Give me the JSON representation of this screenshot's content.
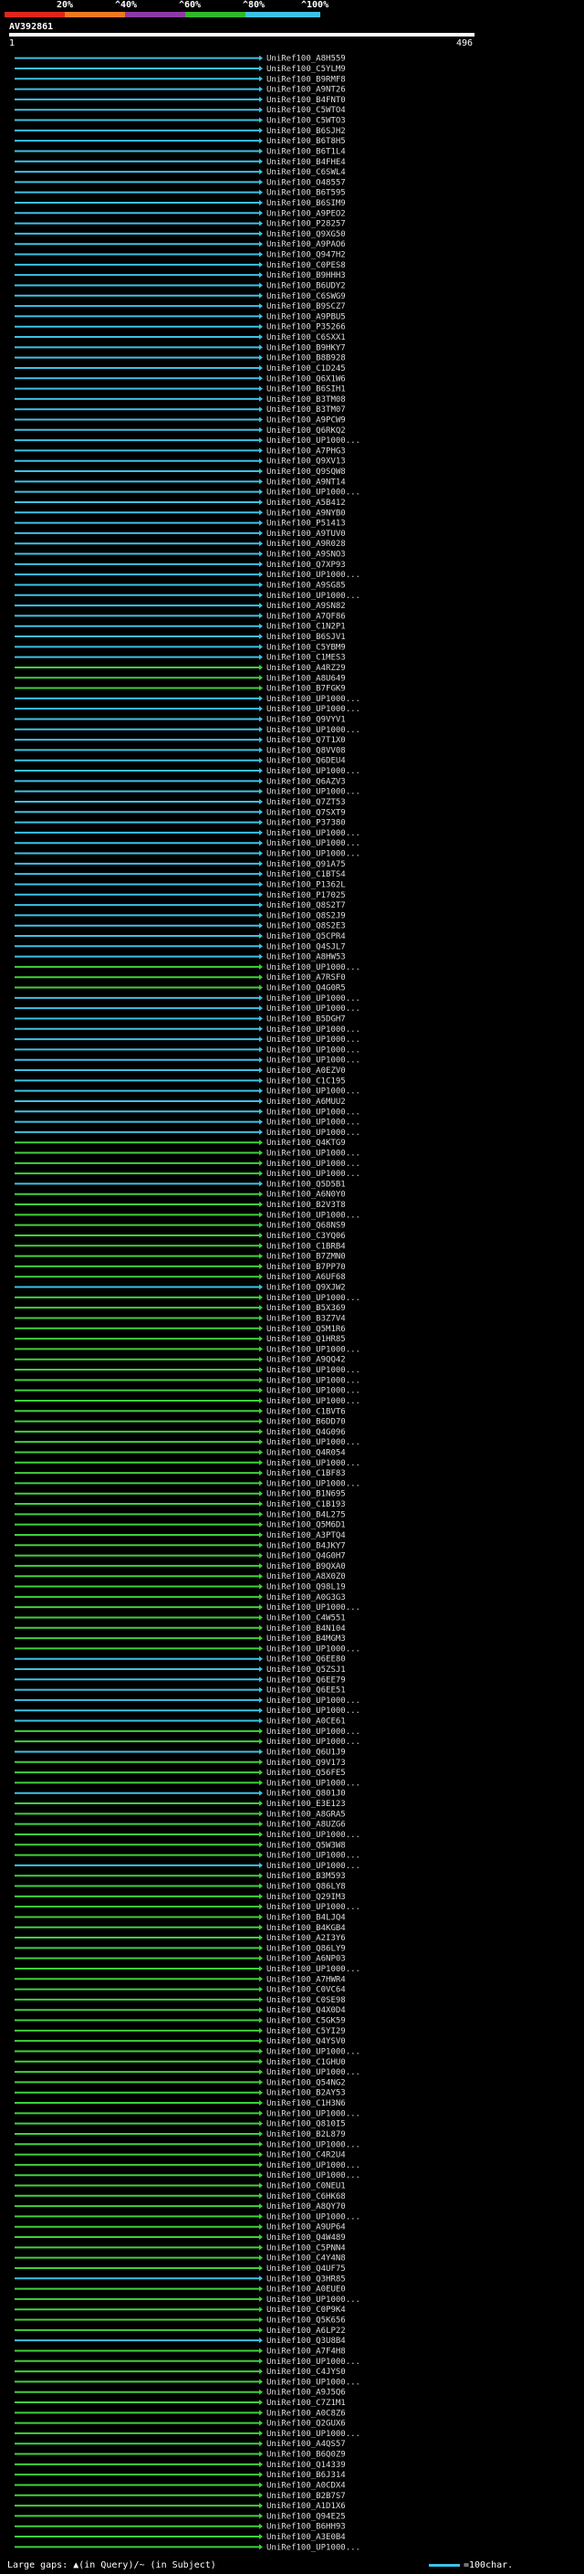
{
  "colors": {
    "bg": "#000000",
    "blue": "#3cc3e6",
    "green": "#3ed23a",
    "gap": "#ffd23c",
    "label": "#dddddd",
    "scale": [
      "#e1261c",
      "#ee7a20",
      "#8c3aa6",
      "#2fb82a",
      "#3cc3e6"
    ]
  },
  "scale": {
    "labels": [
      "20%",
      "^40%",
      "^60%",
      "^80%",
      "^100%"
    ]
  },
  "query": {
    "id": "AV392861",
    "start": "1",
    "end": "496"
  },
  "legend": {
    "gaps": "Large gaps: ▲(in Query)/~ (in Subject)",
    "unit": "=100char."
  },
  "hits": [
    {
      "id": "UniRef100_A8H559",
      "color": "blue"
    },
    {
      "id": "UniRef100_C5YLM9",
      "color": "blue"
    },
    {
      "id": "UniRef100_B9RMF8",
      "color": "blue"
    },
    {
      "id": "UniRef100_A9NT26",
      "color": "blue"
    },
    {
      "id": "UniRef100_B4FNT0",
      "color": "blue"
    },
    {
      "id": "UniRef100_C5WTO4",
      "color": "blue"
    },
    {
      "id": "UniRef100_C5WTO3",
      "color": "blue"
    },
    {
      "id": "UniRef100_B6SJH2",
      "color": "blue"
    },
    {
      "id": "UniRef100_B6T8H5",
      "color": "blue"
    },
    {
      "id": "UniRef100_B6T1L4",
      "color": "blue"
    },
    {
      "id": "UniRef100_B4FHE4",
      "color": "blue"
    },
    {
      "id": "UniRef100_C6SWL4",
      "color": "blue"
    },
    {
      "id": "UniRef100_O48557",
      "color": "blue"
    },
    {
      "id": "UniRef100_B6T595",
      "color": "blue"
    },
    {
      "id": "UniRef100_B6SIM9",
      "color": "blue"
    },
    {
      "id": "UniRef100_A9PEO2",
      "color": "blue"
    },
    {
      "id": "UniRef100_P28257",
      "color": "blue"
    },
    {
      "id": "UniRef100_Q9XG50",
      "color": "blue"
    },
    {
      "id": "UniRef100_A9PAO6",
      "color": "blue"
    },
    {
      "id": "UniRef100_Q947H2",
      "color": "blue"
    },
    {
      "id": "UniRef100_C0PES8",
      "color": "blue"
    },
    {
      "id": "UniRef100_B9HHH3",
      "color": "blue"
    },
    {
      "id": "UniRef100_B6UDY2",
      "color": "blue"
    },
    {
      "id": "UniRef100_C6SWG9",
      "color": "blue"
    },
    {
      "id": "UniRef100_B9SCZ7",
      "color": "blue"
    },
    {
      "id": "UniRef100_A9PBU5",
      "color": "blue"
    },
    {
      "id": "UniRef100_P35266",
      "color": "blue"
    },
    {
      "id": "UniRef100_C6SXX1",
      "color": "blue"
    },
    {
      "id": "UniRef100_B9HKY7",
      "color": "blue"
    },
    {
      "id": "UniRef100_B8B928",
      "color": "blue"
    },
    {
      "id": "UniRef100_C1D245",
      "color": "blue"
    },
    {
      "id": "UniRef100_Q6X1W6",
      "color": "blue"
    },
    {
      "id": "UniRef100_B6SIH1",
      "color": "blue"
    },
    {
      "id": "UniRef100_B3TM08",
      "color": "blue"
    },
    {
      "id": "UniRef100_B3TM07",
      "color": "blue"
    },
    {
      "id": "UniRef100_A9PCW9",
      "color": "blue"
    },
    {
      "id": "UniRef100_Q6RKQ2",
      "color": "blue"
    },
    {
      "id": "UniRef100_UP1000...",
      "color": "blue"
    },
    {
      "id": "UniRef100_A7PHG3",
      "color": "blue"
    },
    {
      "id": "UniRef100_Q9XV13",
      "color": "blue"
    },
    {
      "id": "UniRef100_Q9SQW8",
      "color": "blue"
    },
    {
      "id": "UniRef100_A9NT14",
      "color": "blue"
    },
    {
      "id": "UniRef100_UP1000...",
      "color": "blue"
    },
    {
      "id": "UniRef100_A5B412",
      "color": "blue"
    },
    {
      "id": "UniRef100_A9NYB0",
      "color": "blue"
    },
    {
      "id": "UniRef100_P51413",
      "color": "blue"
    },
    {
      "id": "UniRef100_A9TUV0",
      "color": "blue"
    },
    {
      "id": "UniRef100_A9R028",
      "color": "blue"
    },
    {
      "id": "UniRef100_A9SNO3",
      "color": "blue"
    },
    {
      "id": "UniRef100_Q7XP93",
      "color": "blue"
    },
    {
      "id": "UniRef100_UP1000...",
      "color": "blue"
    },
    {
      "id": "UniRef100_A9SG85",
      "color": "blue"
    },
    {
      "id": "UniRef100_UP1000...",
      "color": "blue"
    },
    {
      "id": "UniRef100_A9SN82",
      "color": "blue"
    },
    {
      "id": "UniRef100_A7QF86",
      "color": "blue"
    },
    {
      "id": "UniRef100_C1N2P1",
      "color": "blue"
    },
    {
      "id": "UniRef100_B6SJV1",
      "color": "blue"
    },
    {
      "id": "UniRef100_C5YBM9",
      "color": "blue"
    },
    {
      "id": "UniRef100_C1MES3",
      "color": "blue"
    },
    {
      "id": "UniRef100_A4RZ29",
      "color": "green"
    },
    {
      "id": "UniRef100_A8U649",
      "color": "green"
    },
    {
      "id": "UniRef100_B7FGK9",
      "color": "green"
    },
    {
      "id": "UniRef100_UP1000...",
      "color": "blue"
    },
    {
      "id": "UniRef100_UP1000...",
      "color": "blue"
    },
    {
      "id": "UniRef100_Q9VYV1",
      "color": "blue"
    },
    {
      "id": "UniRef100_UP1000...",
      "color": "blue"
    },
    {
      "id": "UniRef100_Q7T1X0",
      "color": "blue"
    },
    {
      "id": "UniRef100_Q8VV08",
      "color": "blue"
    },
    {
      "id": "UniRef100_Q6DEU4",
      "color": "blue"
    },
    {
      "id": "UniRef100_UP1000...",
      "color": "blue"
    },
    {
      "id": "UniRef100_Q6AZV3",
      "color": "blue"
    },
    {
      "id": "UniRef100_UP1000...",
      "color": "blue"
    },
    {
      "id": "UniRef100_Q7ZT53",
      "color": "blue"
    },
    {
      "id": "UniRef100_Q7SXT9",
      "color": "blue"
    },
    {
      "id": "UniRef100_P37380",
      "color": "blue"
    },
    {
      "id": "UniRef100_UP1000...",
      "color": "blue"
    },
    {
      "id": "UniRef100_UP1000...",
      "color": "blue"
    },
    {
      "id": "UniRef100_UP1000...",
      "color": "blue"
    },
    {
      "id": "UniRef100_Q91A75",
      "color": "blue"
    },
    {
      "id": "UniRef100_C1BTS4",
      "color": "blue"
    },
    {
      "id": "UniRef100_P1362L",
      "color": "blue"
    },
    {
      "id": "UniRef100_P17025",
      "color": "blue"
    },
    {
      "id": "UniRef100_Q8S2T7",
      "color": "blue"
    },
    {
      "id": "UniRef100_Q8S2J9",
      "color": "blue"
    },
    {
      "id": "UniRef100_Q8S2E3",
      "color": "blue"
    },
    {
      "id": "UniRef100_Q5CPR4",
      "color": "blue"
    },
    {
      "id": "UniRef100_Q4SJL7",
      "color": "blue"
    },
    {
      "id": "UniRef100_A8HW53",
      "color": "blue"
    },
    {
      "id": "UniRef100_UP1000...",
      "color": "green"
    },
    {
      "id": "UniRef100_A7RSF0",
      "color": "green"
    },
    {
      "id": "UniRef100_Q4G0R5",
      "color": "green"
    },
    {
      "id": "UniRef100_UP1000...",
      "color": "blue"
    },
    {
      "id": "UniRef100_UP1000...",
      "color": "blue"
    },
    {
      "id": "UniRef100_B5DGH7",
      "color": "blue"
    },
    {
      "id": "UniRef100_UP1000...",
      "color": "blue"
    },
    {
      "id": "UniRef100_UP1000...",
      "color": "blue"
    },
    {
      "id": "UniRef100_UP1000...",
      "color": "blue"
    },
    {
      "id": "UniRef100_UP1000...",
      "color": "blue"
    },
    {
      "id": "UniRef100_A0EZV0",
      "color": "blue"
    },
    {
      "id": "UniRef100_C1C195",
      "color": "blue"
    },
    {
      "id": "UniRef100_UP1000...",
      "color": "blue"
    },
    {
      "id": "UniRef100_A6MUU2",
      "color": "blue"
    },
    {
      "id": "UniRef100_UP1000...",
      "color": "blue"
    },
    {
      "id": "UniRef100_UP1000...",
      "color": "blue"
    },
    {
      "id": "UniRef100_UP1000...",
      "color": "blue"
    },
    {
      "id": "UniRef100_Q4KTG9",
      "color": "green"
    },
    {
      "id": "UniRef100_UP1000...",
      "color": "green"
    },
    {
      "id": "UniRef100_UP1000...",
      "color": "green"
    },
    {
      "id": "UniRef100_UP1000...",
      "color": "green"
    },
    {
      "id": "UniRef100_Q5D5B1",
      "color": "blue"
    },
    {
      "id": "UniRef100_A6N0Y0",
      "color": "green"
    },
    {
      "id": "UniRef100_B2V3T8",
      "color": "green"
    },
    {
      "id": "UniRef100_UP1000...",
      "color": "green"
    },
    {
      "id": "UniRef100_Q68NS9",
      "color": "green"
    },
    {
      "id": "UniRef100_C3YQ06",
      "color": "green"
    },
    {
      "id": "UniRef100_C1BRB4",
      "color": "green"
    },
    {
      "id": "UniRef100_B7ZMN0",
      "color": "green"
    },
    {
      "id": "UniRef100_B7PP70",
      "color": "green"
    },
    {
      "id": "UniRef100_A6UF68",
      "color": "green"
    },
    {
      "id": "UniRef100_Q9XJW2",
      "color": "blue"
    },
    {
      "id": "UniRef100_UP1000...",
      "color": "green"
    },
    {
      "id": "UniRef100_B5X369",
      "color": "green"
    },
    {
      "id": "UniRef100_B3Z7V4",
      "color": "green"
    },
    {
      "id": "UniRef100_Q5M1R6",
      "color": "green"
    },
    {
      "id": "UniRef100_Q1HR85",
      "color": "green"
    },
    {
      "id": "UniRef100_UP1000...",
      "color": "green"
    },
    {
      "id": "UniRef100_A9QQ42",
      "color": "green"
    },
    {
      "id": "UniRef100_UP1000...",
      "color": "green"
    },
    {
      "id": "UniRef100_UP1000...",
      "color": "green"
    },
    {
      "id": "UniRef100_UP1000...",
      "color": "green"
    },
    {
      "id": "UniRef100_UP1000...",
      "color": "green"
    },
    {
      "id": "UniRef100_C1BVT6",
      "color": "green"
    },
    {
      "id": "UniRef100_B6DD70",
      "color": "green"
    },
    {
      "id": "UniRef100_Q4G096",
      "color": "green"
    },
    {
      "id": "UniRef100_UP1000...",
      "color": "green"
    },
    {
      "id": "UniRef100_Q4R054",
      "color": "green"
    },
    {
      "id": "UniRef100_UP1000...",
      "color": "green"
    },
    {
      "id": "UniRef100_C1BF83",
      "color": "green"
    },
    {
      "id": "UniRef100_UP1000...",
      "color": "green"
    },
    {
      "id": "UniRef100_B1N695",
      "color": "green"
    },
    {
      "id": "UniRef100_C1B193",
      "color": "green"
    },
    {
      "id": "UniRef100_B4L275",
      "color": "green"
    },
    {
      "id": "UniRef100_Q5M6D1",
      "color": "green"
    },
    {
      "id": "UniRef100_A3PTQ4",
      "color": "green"
    },
    {
      "id": "UniRef100_B4JKY7",
      "color": "green"
    },
    {
      "id": "UniRef100_Q4G0H7",
      "color": "green"
    },
    {
      "id": "UniRef100_B9QXA0",
      "color": "green"
    },
    {
      "id": "UniRef100_A8X0Z0",
      "color": "green"
    },
    {
      "id": "UniRef100_Q98L19",
      "color": "green"
    },
    {
      "id": "UniRef100_A0G3G3",
      "color": "green"
    },
    {
      "id": "UniRef100_UP1000...",
      "color": "green"
    },
    {
      "id": "UniRef100_C4W551",
      "color": "green"
    },
    {
      "id": "UniRef100_B4N104",
      "color": "green"
    },
    {
      "id": "UniRef100_B4MGM3",
      "color": "green"
    },
    {
      "id": "UniRef100_UP1000...",
      "color": "green"
    },
    {
      "id": "UniRef100_Q6EE80",
      "color": "blue"
    },
    {
      "id": "UniRef100_Q5ZSJ1",
      "color": "blue"
    },
    {
      "id": "UniRef100_Q6EE79",
      "color": "blue"
    },
    {
      "id": "UniRef100_Q6EE51",
      "color": "blue"
    },
    {
      "id": "UniRef100_UP1000...",
      "color": "blue"
    },
    {
      "id": "UniRef100_UP1000...",
      "color": "blue"
    },
    {
      "id": "UniRef100_A0CE61",
      "color": "blue"
    },
    {
      "id": "UniRef100_UP1000...",
      "color": "green"
    },
    {
      "id": "UniRef100_UP1000...",
      "color": "green"
    },
    {
      "id": "UniRef100_Q6U1J9",
      "color": "blue"
    },
    {
      "id": "UniRef100_Q9V173",
      "color": "green"
    },
    {
      "id": "UniRef100_Q56FE5",
      "color": "green"
    },
    {
      "id": "UniRef100_UP1000...",
      "color": "green"
    },
    {
      "id": "UniRef100_Q801J0",
      "color": "blue"
    },
    {
      "id": "UniRef100_E3E123",
      "color": "green"
    },
    {
      "id": "UniRef100_A8GRA5",
      "color": "green"
    },
    {
      "id": "UniRef100_A8UZG6",
      "color": "green"
    },
    {
      "id": "UniRef100_UP1000...",
      "color": "green"
    },
    {
      "id": "UniRef100_Q5W3W8",
      "color": "green"
    },
    {
      "id": "UniRef100_UP1000...",
      "color": "green"
    },
    {
      "id": "UniRef100_UP1000...",
      "color": "blue"
    },
    {
      "id": "UniRef100_B3M593",
      "color": "green"
    },
    {
      "id": "UniRef100_Q86LY8",
      "color": "green"
    },
    {
      "id": "UniRef100_Q29IM3",
      "color": "green"
    },
    {
      "id": "UniRef100_UP1000...",
      "color": "green"
    },
    {
      "id": "UniRef100_B4LJQ4",
      "color": "green"
    },
    {
      "id": "UniRef100_B4KGB4",
      "color": "green"
    },
    {
      "id": "UniRef100_A2I3Y6",
      "color": "green"
    },
    {
      "id": "UniRef100_Q86LY9",
      "color": "green"
    },
    {
      "id": "UniRef100_A6NP03",
      "color": "green"
    },
    {
      "id": "UniRef100_UP1000...",
      "color": "green"
    },
    {
      "id": "UniRef100_A7HWR4",
      "color": "green"
    },
    {
      "id": "UniRef100_C0VC64",
      "color": "green"
    },
    {
      "id": "UniRef100_C0SE98",
      "color": "green"
    },
    {
      "id": "UniRef100_Q4X0D4",
      "color": "green"
    },
    {
      "id": "UniRef100_C5GK59",
      "color": "green"
    },
    {
      "id": "UniRef100_C5YI29",
      "color": "green"
    },
    {
      "id": "UniRef100_Q4YSV0",
      "color": "green"
    },
    {
      "id": "UniRef100_UP1000...",
      "color": "green"
    },
    {
      "id": "UniRef100_C1GHU0",
      "color": "green"
    },
    {
      "id": "UniRef100_UP1000...",
      "color": "green"
    },
    {
      "id": "UniRef100_Q54NG2",
      "color": "green"
    },
    {
      "id": "UniRef100_B2AY53",
      "color": "green"
    },
    {
      "id": "UniRef100_C1H3N6",
      "color": "green"
    },
    {
      "id": "UniRef100_UP1000...",
      "color": "green"
    },
    {
      "id": "UniRef100_Q810I5",
      "color": "green"
    },
    {
      "id": "UniRef100_B2L879",
      "color": "green"
    },
    {
      "id": "UniRef100_UP1000...",
      "color": "green"
    },
    {
      "id": "UniRef100_C4R2U4",
      "color": "green"
    },
    {
      "id": "UniRef100_UP1000...",
      "color": "green"
    },
    {
      "id": "UniRef100_UP1000...",
      "color": "green"
    },
    {
      "id": "UniRef100_C0NEU1",
      "color": "green"
    },
    {
      "id": "UniRef100_C6HK68",
      "color": "green"
    },
    {
      "id": "UniRef100_A8QY70",
      "color": "green"
    },
    {
      "id": "UniRef100_UP1000...",
      "color": "green"
    },
    {
      "id": "UniRef100_A9UP64",
      "color": "green"
    },
    {
      "id": "UniRef100_Q4W489",
      "color": "green"
    },
    {
      "id": "UniRef100_C5PNN4",
      "color": "green"
    },
    {
      "id": "UniRef100_C4Y4N8",
      "color": "green"
    },
    {
      "id": "UniRef100_Q4UF75",
      "color": "green"
    },
    {
      "id": "UniRef100_Q3HR85",
      "color": "blue"
    },
    {
      "id": "UniRef100_A0EUE0",
      "color": "green"
    },
    {
      "id": "UniRef100_UP1000...",
      "color": "green"
    },
    {
      "id": "UniRef100_C0P9K4",
      "color": "green"
    },
    {
      "id": "UniRef100_Q5K656",
      "color": "green"
    },
    {
      "id": "UniRef100_A6LP22",
      "color": "green"
    },
    {
      "id": "UniRef100_Q3U8B4",
      "color": "blue"
    },
    {
      "id": "UniRef100_A7F4H8",
      "color": "green"
    },
    {
      "id": "UniRef100_UP1000...",
      "color": "green"
    },
    {
      "id": "UniRef100_C4JYS0",
      "color": "green"
    },
    {
      "id": "UniRef100_UP1000...",
      "color": "green"
    },
    {
      "id": "UniRef100_A9J5Q6",
      "color": "green"
    },
    {
      "id": "UniRef100_C7Z1M1",
      "color": "green"
    },
    {
      "id": "UniRef100_A0C8Z6",
      "color": "green"
    },
    {
      "id": "UniRef100_Q2GUX6",
      "color": "green"
    },
    {
      "id": "UniRef100_UP1000...",
      "color": "green"
    },
    {
      "id": "UniRef100_A4QS57",
      "color": "green"
    },
    {
      "id": "UniRef100_B6Q0Z9",
      "color": "green"
    },
    {
      "id": "UniRef100_Q14339",
      "color": "green"
    },
    {
      "id": "UniRef100_B6J314",
      "color": "green"
    },
    {
      "id": "UniRef100_A0CDX4",
      "color": "green"
    },
    {
      "id": "UniRef100_B2B7S7",
      "color": "green"
    },
    {
      "id": "UniRef100_A1D1X6",
      "color": "green"
    },
    {
      "id": "UniRef100_Q94E25",
      "color": "green"
    },
    {
      "id": "UniRef100_B6HH93",
      "color": "green"
    },
    {
      "id": "UniRef100_A3E0B4",
      "color": "green"
    },
    {
      "id": "UniRef100_UP1000...",
      "color": "green"
    }
  ]
}
